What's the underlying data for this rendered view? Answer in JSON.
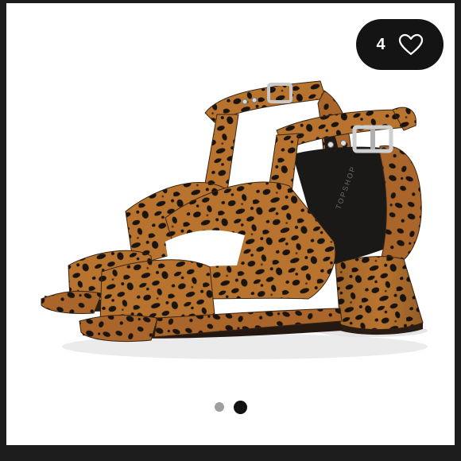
{
  "listing": {
    "like_count": "4",
    "like_icon": "heart-outline-icon",
    "image_subject": "leopard-print-block-heel-sandals",
    "carousel": {
      "total": 2,
      "active_index": 1
    }
  },
  "colors": {
    "page_background": "#1d1d1d",
    "card_background": "#ffffff",
    "like_button_background": "#141414",
    "dot_active": "#121212",
    "dot_inactive": "#9e9e9e",
    "leopard_base": "#b8742f",
    "leopard_spot": "#1a1410"
  }
}
